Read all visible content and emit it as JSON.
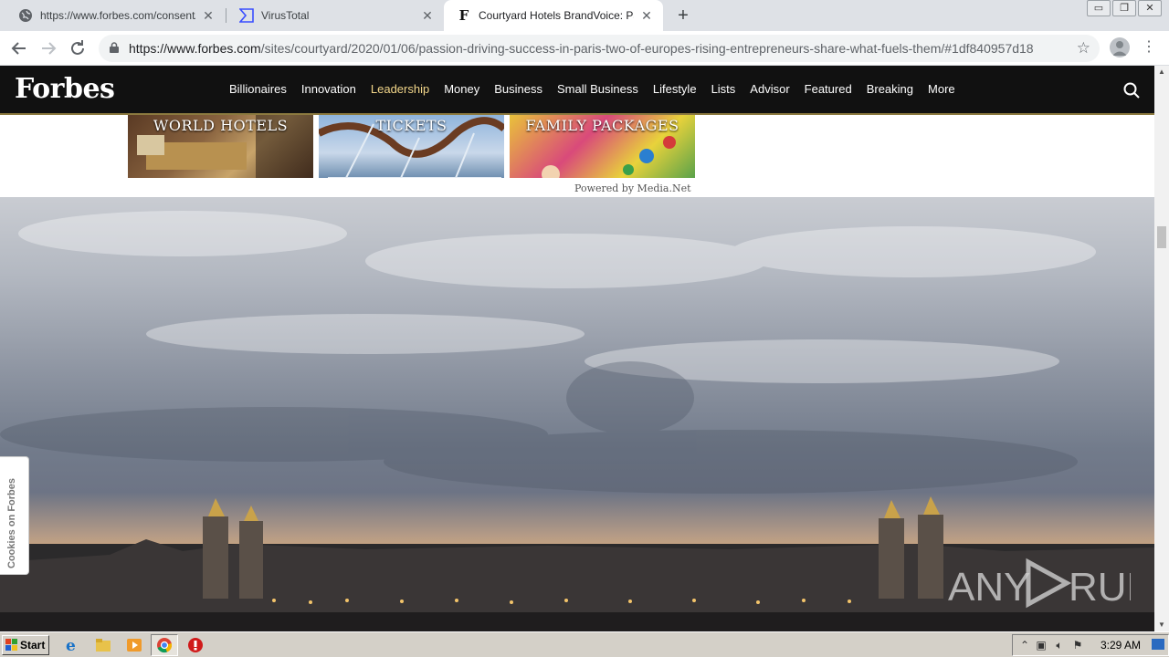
{
  "browser": {
    "tabs": [
      {
        "title": "https://www.forbes.com/consent/?t",
        "icon": "globe-icon",
        "active": false
      },
      {
        "title": "VirusTotal",
        "icon": "virustotal-icon",
        "active": false
      },
      {
        "title": "Courtyard Hotels BrandVoice: Passio",
        "icon": "forbes-f-icon",
        "active": true
      }
    ],
    "url_host": "https://www.forbes.com",
    "url_path": "/sites/courtyard/2020/01/06/passion-driving-success-in-paris-two-of-europes-rising-entrepreneurs-share-what-fuels-them/#1df840957d18"
  },
  "forbes": {
    "logo": "Forbes",
    "nav": [
      "Billionaires",
      "Innovation",
      "Leadership",
      "Money",
      "Business",
      "Small Business",
      "Lifestyle",
      "Lists",
      "Advisor",
      "Featured",
      "Breaking",
      "More"
    ],
    "highlighted_nav": "Leadership"
  },
  "ads": {
    "items": [
      "WORLD HOTELS",
      "TICKETS",
      "FAMILY PACKAGES"
    ],
    "powered_by": "Powered by Media.Net"
  },
  "cookies_tab": "Cookies on Forbes",
  "watermark": "ANY RUN",
  "taskbar": {
    "start_label": "Start",
    "clock": "3:29 AM"
  },
  "colors": {
    "forbes_nav_bg": "#111111",
    "nav_highlight": "#f2d68a",
    "tab_strip": "#dee1e6",
    "taskbar": "#d4d0c8"
  }
}
